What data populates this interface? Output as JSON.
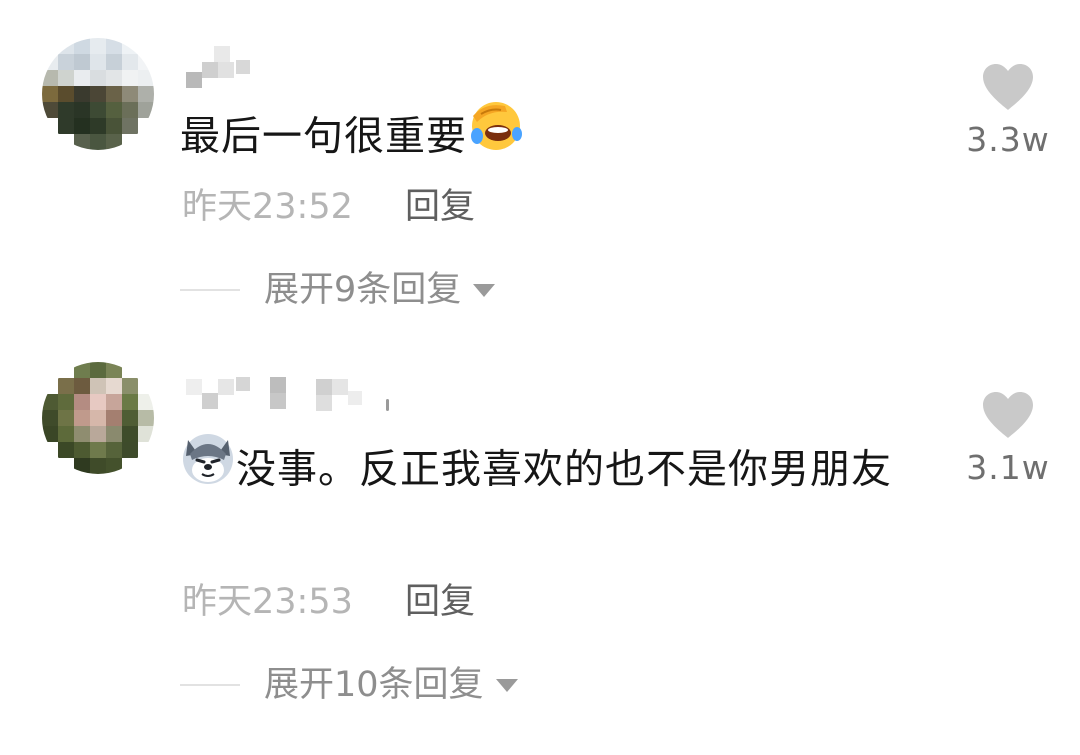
{
  "comments": [
    {
      "text": "最后一句很重要",
      "emoji_icon": "facepalm-laugh-emoji",
      "time": "昨天23:52",
      "reply_label": "回复",
      "expand_label": "展开9条回复",
      "like_count": "3.3w"
    },
    {
      "text": "没事。反正我喜欢的也不是你男朋友",
      "emoji_icon": "husky-dog-emoji",
      "time": "昨天23:53",
      "reply_label": "回复",
      "expand_label": "展开10条回复",
      "like_count": "3.1w"
    }
  ],
  "colors": {
    "text": "#161616",
    "meta": "#b5b5b5",
    "reply": "#5f5f5f",
    "expand": "#8e8e8e",
    "heart": "#c9c9c9"
  }
}
